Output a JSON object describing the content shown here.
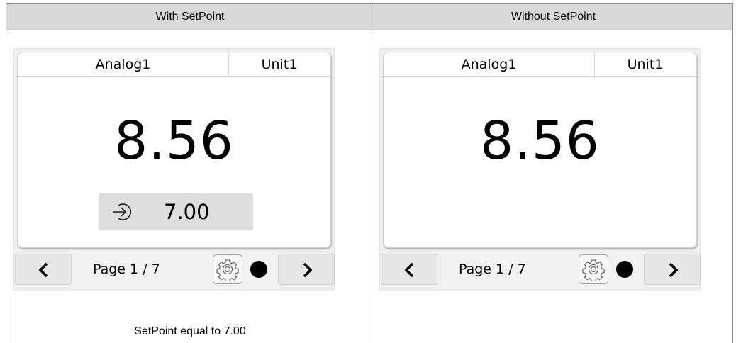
{
  "columns": {
    "left_title": "With SetPoint",
    "right_title": "Without SetPoint"
  },
  "left_panel": {
    "channel_name": "Analog1",
    "unit": "Unit1",
    "value": "8.56",
    "setpoint_value": "7.00",
    "page_label": "Page 1 / 7"
  },
  "right_panel": {
    "channel_name": "Analog1",
    "unit": "Unit1",
    "value": "8.56",
    "page_label": "Page 1 / 7"
  },
  "caption": "SetPoint equal to 7.00",
  "icons": {
    "prev": "chevron-left-icon",
    "next": "chevron-right-icon",
    "settings": "gear-icon",
    "status": "status-dot",
    "setpoint": "setpoint-arrow-icon"
  },
  "colors": {
    "header_bg": "#d9d9d9",
    "device_bg": "#f1f1f1",
    "setpoint_box": "#dedede",
    "status_dot": "#000000"
  }
}
